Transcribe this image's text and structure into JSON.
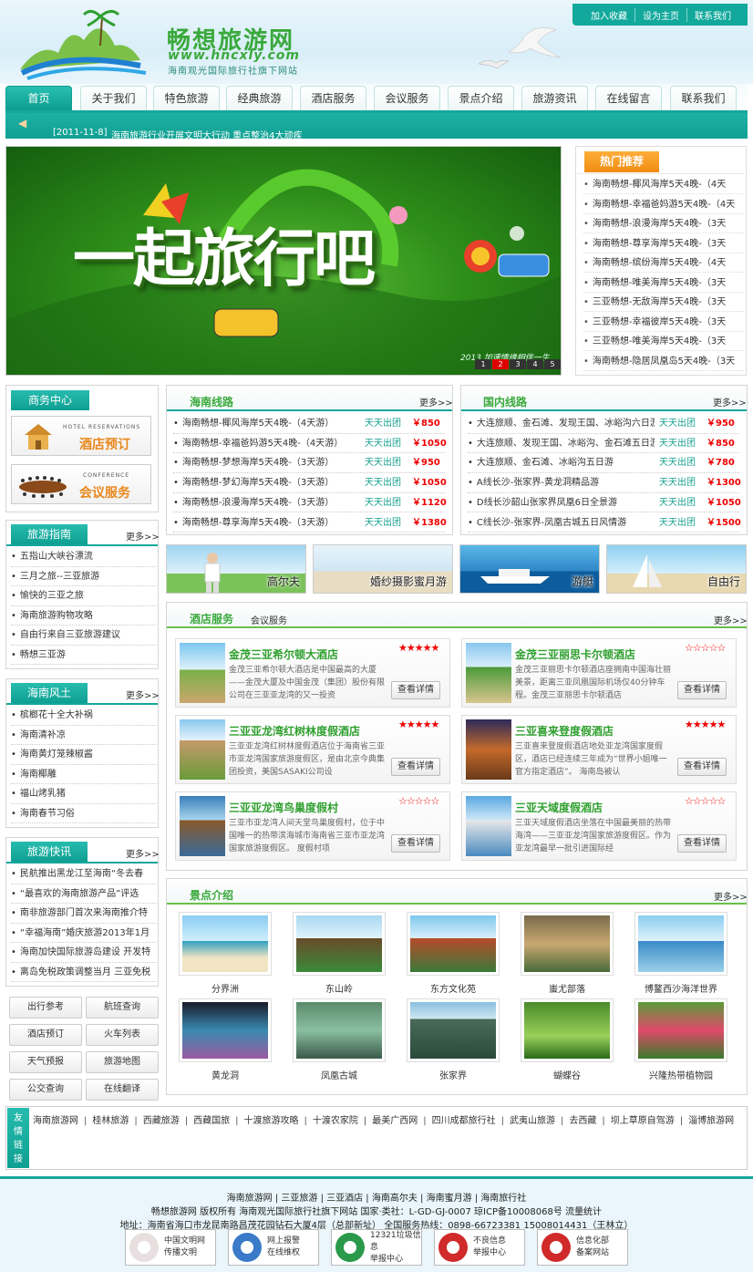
{
  "header": {
    "brand_title": "畅想旅游网",
    "brand_url": "www.hncxly.com",
    "brand_sub": "海南观光国际旅行社旗下网站",
    "top_links": [
      "加入收藏",
      "设为主页",
      "联系我们"
    ]
  },
  "nav": {
    "items": [
      "首页",
      "关于我们",
      "特色旅游",
      "经典旅游",
      "酒店服务",
      "会议服务",
      "景点介绍",
      "旅游资讯",
      "在线留言",
      "联系我们"
    ],
    "active": 0
  },
  "news": {
    "date": "[2011-11-8]",
    "text": "海南旅游行业开展文明大行动 重点整治4大顽疾"
  },
  "banner": {
    "title": "一起旅行吧",
    "slogan": "2013 加速情缘相伴一生",
    "pages": [
      "1",
      "2",
      "3",
      "4",
      "5"
    ],
    "active_page": 1
  },
  "hot": {
    "title": "热门推荐",
    "items": [
      "海南畅想-椰风海岸5天4晚-（4天",
      "海南畅想-幸福爸妈游5天4晚-（4天",
      "海南畅想-浪漫海岸5天4晚-（3天",
      "海南畅想-尊享海岸5天4晚-（3天",
      "海南畅想-缤纷海岸5天4晚-（4天",
      "海南畅想-唯美海岸5天4晚-（3天",
      "三亚畅想-无敌海岸5天4晚-（3天",
      "三亚畅想-幸福彼岸5天4晚-（3天",
      "三亚畅想-唯美海岸5天4晚-（3天",
      "海南畅想-隐居凤凰岛5天4晚-（3天"
    ]
  },
  "business": {
    "title": "商务中心",
    "hotel_en": "HOTEL RESERVATIONS",
    "hotel_cn": "酒店预订",
    "conf_en": "CONFERENCE",
    "conf_cn": "会议服务"
  },
  "guide": {
    "title": "旅游指南",
    "more": "更多>>",
    "items": [
      "五指山大峡谷漂流",
      "三月之旅--三亚旅游",
      "愉快的三亚之旅",
      "海南旅游购物攻略",
      "自由行来自三亚旅游建议",
      "畅想三亚游"
    ]
  },
  "customs": {
    "title": "海南风土",
    "more": "更多>>",
    "items": [
      "槟榔花十全大补祸",
      "海南清补凉",
      "海南黄灯笼辣椒酱",
      "海南椰雕",
      "福山烤乳猪",
      "海南春节习俗"
    ]
  },
  "flash": {
    "title": "旅游快讯",
    "more": "更多>>",
    "items": [
      "民航推出黑龙江至海南“冬去春",
      "“最喜欢的海南旅游产品”评选",
      "南非旅游部门首次来海南推介特",
      "“幸福海南”婚庆旅游2013年1月",
      "海南加快国际旅游岛建设 开发特",
      "离岛免税政策调整当月 三亚免税"
    ]
  },
  "quick": [
    "出行参考",
    "航班查询",
    "酒店预订",
    "火车列表",
    "天气预报",
    "旅游地图",
    "公交查询",
    "在线翻译"
  ],
  "hainan_routes": {
    "title": "海南线路",
    "more": "更多>>",
    "rows": [
      {
        "name": "海南畅想-椰风海岸5天4晚-（4天游）",
        "dep": "天天出团",
        "price": "￥850"
      },
      {
        "name": "海南畅想-幸福爸妈游5天4晚-（4天游）",
        "dep": "天天出团",
        "price": "￥1050"
      },
      {
        "name": "海南畅想-梦想海岸5天4晚-（3天游）",
        "dep": "天天出团",
        "price": "￥950"
      },
      {
        "name": "海南畅想-梦幻海岸5天4晚-（3天游）",
        "dep": "天天出团",
        "price": "￥1050"
      },
      {
        "name": "海南畅想-浪漫海岸5天4晚-（3天游）",
        "dep": "天天出团",
        "price": "￥1120"
      },
      {
        "name": "海南畅想-尊享海岸5天4晚-（3天游）",
        "dep": "天天出团",
        "price": "￥1380"
      }
    ]
  },
  "domestic_routes": {
    "title": "国内线路",
    "more": "更多>>",
    "rows": [
      {
        "name": "大连旅顺、金石滩、发现王国、冰峪沟六日游",
        "dep": "天天出团",
        "price": "￥950"
      },
      {
        "name": "大连旅顺、发现王国、冰峪沟、金石滩五日游",
        "dep": "天天出团",
        "price": "￥850"
      },
      {
        "name": "大连旅顺、金石滩、冰峪沟五日游",
        "dep": "天天出团",
        "price": "￥780"
      },
      {
        "name": "A线长沙-张家界-黄龙洞精品游",
        "dep": "天天出团",
        "price": "￥1300"
      },
      {
        "name": "D线长沙韶山张家界凤凰6日全景游",
        "dep": "天天出团",
        "price": "￥1050"
      },
      {
        "name": "C线长沙-张家界-凤凰古城五日风情游",
        "dep": "天天出团",
        "price": "￥1500"
      }
    ]
  },
  "tiles": [
    "高尔夫",
    "婚纱摄影蜜月游",
    "游艇",
    "自由行"
  ],
  "hotels": {
    "tab_active": "酒店服务",
    "tab_other": "会议服务",
    "more": "更多>>",
    "btn": "查看详情",
    "items": [
      {
        "name": "金茂三亚希尔顿大酒店",
        "stars": "★★★★★",
        "desc": "金茂三亚希尔顿大酒店是中国最高的大厦——金茂大厦及中国金茂（集团）股份有限公司在三亚亚龙湾的又一投资"
      },
      {
        "name": "金茂三亚丽思卡尔顿酒店",
        "stars": "☆☆☆☆☆",
        "desc": "金茂三亚丽思卡尔顿酒店座拥南中国海壮丽美景，距离三亚凤凰国际机场仅40分钟车程。金茂三亚丽思卡尔顿酒店"
      },
      {
        "name": "三亚亚龙湾红树林度假酒店",
        "stars": "★★★★★",
        "desc": "三亚亚龙湾红树林度假酒店位于海南省三亚市亚龙湾国家旅游度假区，是由北京今典集团投资，美国SASAKI公司设"
      },
      {
        "name": "三亚喜来登度假酒店",
        "stars": "★★★★★",
        "desc": "三亚喜来登度假酒店地处亚龙湾国家度假区，酒店已经连续三年成为“世界小姐唯一官方指定酒店”。 海南岛被认"
      },
      {
        "name": "三亚亚龙湾鸟巢度假村",
        "stars": "☆☆☆☆☆",
        "desc": "三亚市亚龙湾人间天堂鸟巢度假村，位于中国唯一的热带滨海城市海南省三亚市亚龙湾国家旅游度假区。 度假村项"
      },
      {
        "name": "三亚天域度假酒店",
        "stars": "☆☆☆☆☆",
        "desc": "三亚天域度假酒店坐落在中国最美丽的热带海湾——三亚亚龙湾国家旅游度假区。作为亚龙湾最早一批引进国际经"
      }
    ]
  },
  "spots": {
    "title": "景点介绍",
    "more": "更多>>",
    "items": [
      "分界洲",
      "东山岭",
      "东方文化苑",
      "蚩尤部落",
      "博鳌西沙海洋世界",
      "黄龙洞",
      "凤凰古城",
      "张家界",
      "蝴蝶谷",
      "兴隆热带植物园"
    ]
  },
  "friend_links": {
    "title": "友情链接",
    "items": [
      "海南旅游网",
      "桂林旅游",
      "西藏旅游",
      "西藏国旅",
      "十渡旅游攻略",
      "十渡农家院",
      "最美广西网",
      "四川成都旅行社",
      "武夷山旅游",
      "去西藏",
      "坝上草原自驾游",
      "淄博旅游网"
    ]
  },
  "footer": {
    "line1": "海南旅游网 | 三亚旅游 | 三亚酒店 | 海南高尔夫 | 海南蜜月游 | 海南旅行社",
    "line2": "畅想旅游网 版权所有 海南观光国际旅行社旗下网站 国家·类社：L-GD-GJ-0007 琼ICP备10008068号 流量统计",
    "line3": "地址：海南省海口市龙昆南路昌茂花园钻石大厦4层（总部新址） 全国服务热线：0898-66723381 15008014431（王林立）",
    "badges": [
      {
        "a": "中国文明网",
        "b": "传播文明"
      },
      {
        "a": "网上报警",
        "b": "在线维权"
      },
      {
        "a": "12321垃圾信息",
        "b": "举报中心"
      },
      {
        "a": "不良信息",
        "b": "举报中心"
      },
      {
        "a": "信息化部",
        "b": "备案网站"
      }
    ]
  }
}
